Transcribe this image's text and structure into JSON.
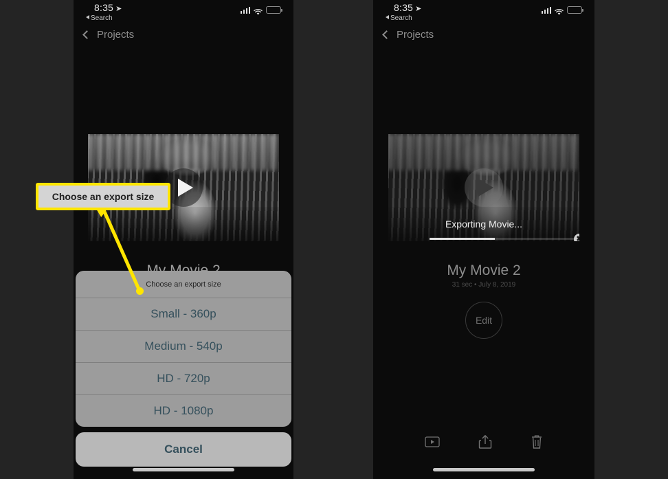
{
  "status_bar": {
    "time": "8:35",
    "location_icon": "location-arrow-icon",
    "back_app_label": "Search",
    "signal_icon": "cellular-signal-icon",
    "wifi_icon": "wifi-icon",
    "battery_icon": "battery-low-power-icon",
    "battery_color": "#f5c518"
  },
  "nav": {
    "back_icon": "chevron-left-icon",
    "back_label": "Projects"
  },
  "left_panel": {
    "video": {
      "play_icon": "play-triangle-icon",
      "alt": "black-and-white video thumbnail of people on a boardwalk"
    },
    "movie_title": "My Movie 2",
    "action_sheet": {
      "title": "Choose an export size",
      "options": [
        "Small - 360p",
        "Medium - 540p",
        "HD - 720p",
        "HD - 1080p"
      ],
      "cancel_label": "Cancel",
      "sheet_bg": "#9c9c9c",
      "text_color": "#35505c"
    },
    "callout": {
      "text": "Choose an export size",
      "border_color": "#ffe500",
      "fill_color": "#d4d4d4"
    }
  },
  "right_panel": {
    "video": {
      "play_icon": "play-triangle-icon",
      "export_status": "Exporting Movie...",
      "progress_percent": 45,
      "close_icon": "close-circle-icon"
    },
    "movie_title": "My Movie 2",
    "movie_meta": "31 sec • July 8, 2019",
    "edit_button_label": "Edit",
    "toolbar": [
      {
        "name": "play-in-rectangle-icon",
        "label": "Play"
      },
      {
        "name": "share-icon",
        "label": "Share"
      },
      {
        "name": "trash-icon",
        "label": "Delete"
      }
    ]
  }
}
